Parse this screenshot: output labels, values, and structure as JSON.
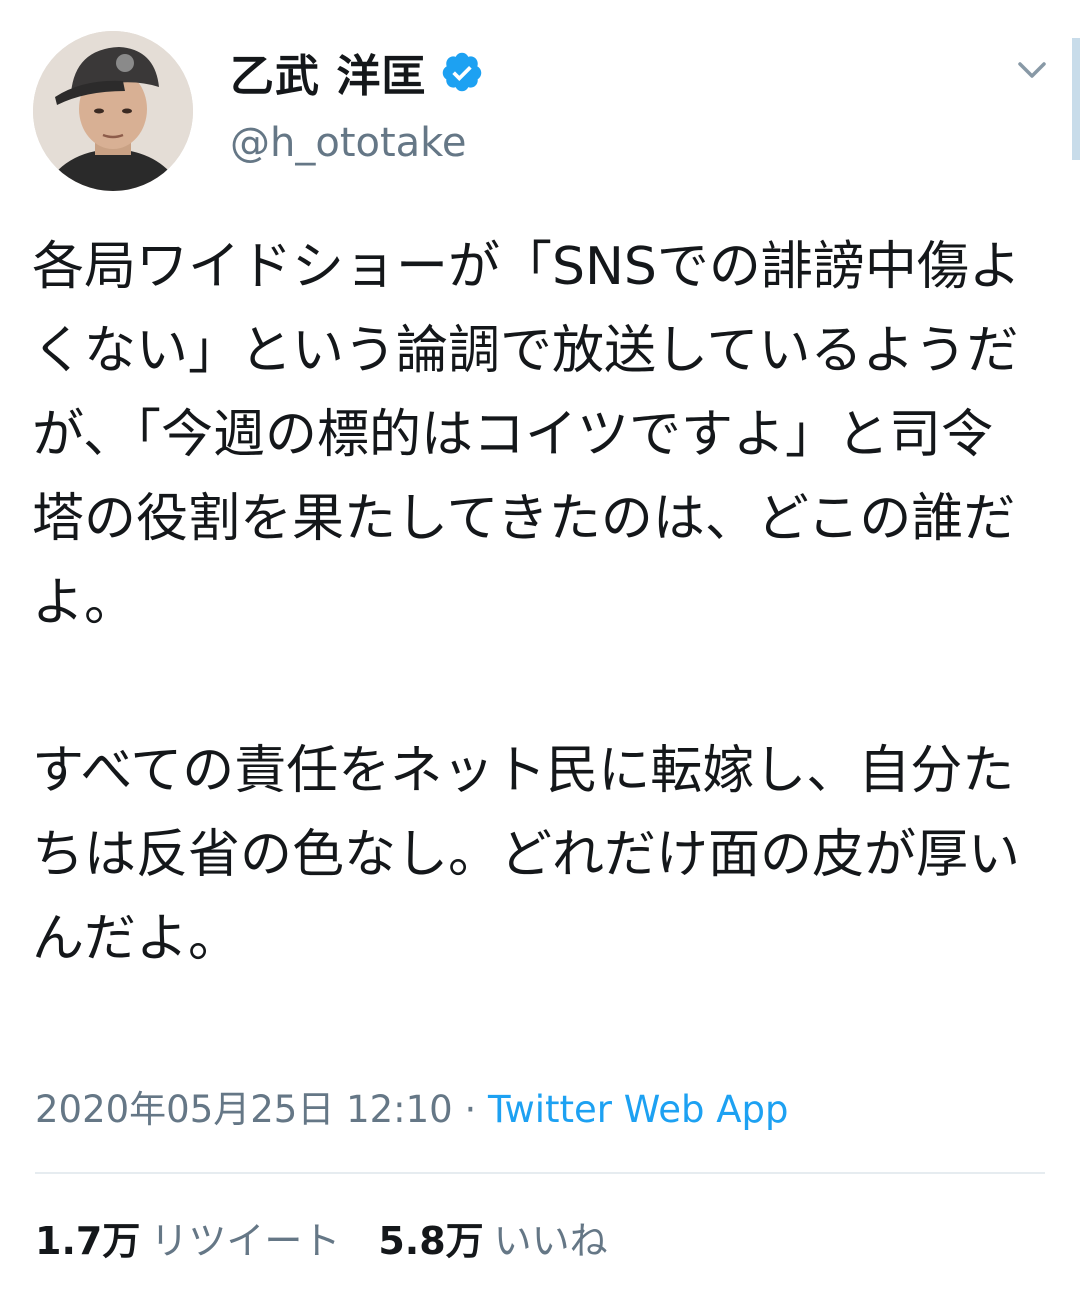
{
  "author": {
    "display_name": "乙武 洋匡",
    "handle": "@h_ototake",
    "verified": true,
    "verified_icon": "verified-badge-icon",
    "avatar_icon": "profile-photo"
  },
  "tweet": {
    "text": "各局ワイドショーが「SNSでの誹謗中傷よくない」という論調で放送しているようだが、「今週の標的はコイツですよ」と司令塔の役割を果たしてきたのは、どこの誰だよ。\n\nすべての責任をネット民に転嫁し、自分たちは反省の色なし。どれだけ面の皮が厚いんだよ。",
    "timestamp": "2020年05月25日 12:10",
    "separator": " · ",
    "source": "Twitter Web App"
  },
  "stats": {
    "retweets_count": "1.7万",
    "retweets_label": "リツイート",
    "likes_count": "5.8万",
    "likes_label": "いいね"
  },
  "colors": {
    "text": "#14171a",
    "secondary": "#657786",
    "accent": "#1da1f2",
    "divider": "#e6ecf0"
  },
  "icons": {
    "menu": "chevron-down-icon"
  }
}
